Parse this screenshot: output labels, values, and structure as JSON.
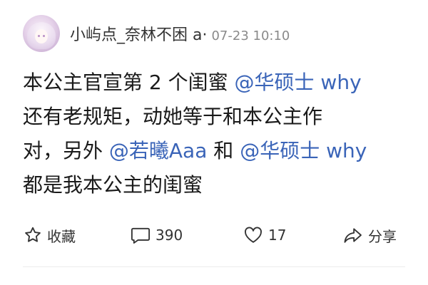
{
  "post": {
    "username": "小屿点_奈林不困 a·",
    "timestamp": "07-23 10:10",
    "content": [
      {
        "text": "本公主官宣第 2 个闺蜜 ",
        "mention": "@华硕士 why"
      },
      {
        "text": "还有老规矩，动她等于和本公主作",
        "mention": ""
      },
      {
        "text": "对，另外 ",
        "mention": "@若曦Aaa",
        "text2": " 和 ",
        "mention2": "@华硕士 why"
      },
      {
        "text": "都是我本公主的闺蜜",
        "mention": ""
      }
    ]
  },
  "actions": {
    "favorite_label": "收藏",
    "favorite_icon": "star-icon",
    "comment_count": "390",
    "comment_icon": "comment-icon",
    "like_count": "17",
    "like_icon": "heart-icon",
    "share_label": "分享",
    "share_icon": "share-icon"
  },
  "colors": {
    "mention": "#3a64b8",
    "text": "#1a1a1a",
    "timestamp": "#8a8a8a"
  }
}
